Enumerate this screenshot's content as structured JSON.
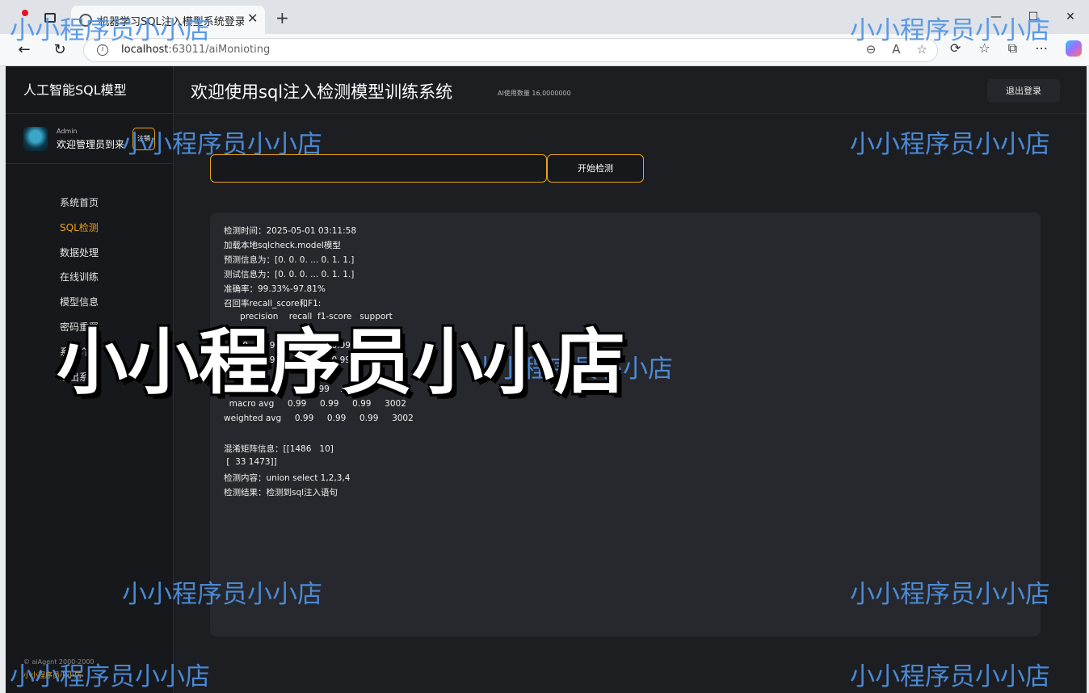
{
  "browser": {
    "tab_title": "机器学习SQL注入模型系统登录界",
    "tab_close": "✕",
    "new_tab": "+",
    "url_host": "localhost",
    "url_rest": ":63011/aiMonioting",
    "win_min": "—",
    "win_max": "☐",
    "win_close": "✕"
  },
  "sidebar": {
    "brand": "人工智能SQL模型",
    "admin_label": "Admin",
    "welcome": "欢迎管理员到来",
    "logout_mini": "注销",
    "items": [
      {
        "label": "系统首页",
        "active": false
      },
      {
        "label": "SQL检测",
        "active": true
      },
      {
        "label": "数据处理",
        "active": false
      },
      {
        "label": "在线训练",
        "active": false
      },
      {
        "label": "模型信息",
        "active": false
      },
      {
        "label": "密码重置",
        "active": false
      },
      {
        "label": "系统介绍",
        "active": false
      },
      {
        "label": "退出系统",
        "active": false
      }
    ],
    "footer_copyright": "© aiAgent 2000-2000",
    "footer_author": "小小程序员小小店"
  },
  "header": {
    "title": "欢迎使用sql注入检测模型训练系统",
    "usage": "AI使用数量 16,0000000",
    "logout": "退出登录"
  },
  "detect": {
    "input_value": "",
    "button": "开始检测"
  },
  "result": {
    "lines": [
      "检测时间：2025-05-01 03:11:58",
      "加载本地sqlcheck.model模型",
      "预测信息为：[0. 0. 0. ... 0. 1. 1.]",
      "测试信息为：[0. 0. 0. ... 0. 1. 1.]",
      "准确率：99.33%-97.81%",
      "召回率recall_score和F1:",
      "      precision    recall  f1-score   support",
      "",
      "    0.0     0.99      0.99      0.99      1496",
      "    1.0     0.99      0.99      0.99      1506",
      "",
      "  accuracy                0.99    3002",
      "  macro avg     0.99     0.99     0.99     3002",
      "weighted avg     0.99     0.99     0.99     3002",
      "",
      "混淆矩阵信息：[[1486   10]",
      " [  33 1473]]",
      "检测内容：union select 1,2,3,4",
      "检测结果：检测到sql注入语句"
    ]
  },
  "watermark": {
    "text": "小小程序员小小店",
    "big": "小小程序员小小店"
  }
}
